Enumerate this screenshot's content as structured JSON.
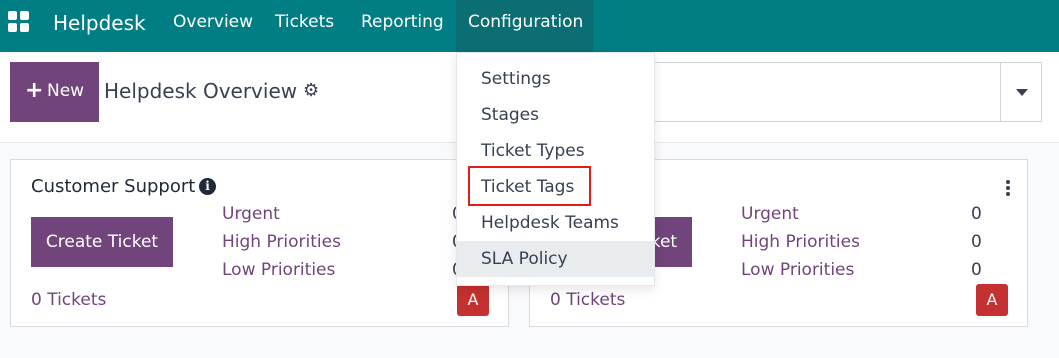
{
  "nav": {
    "brand": "Helpdesk",
    "items": [
      "Overview",
      "Tickets",
      "Reporting"
    ],
    "active": "Configuration"
  },
  "control": {
    "new_label": "New",
    "page_title": "Helpdesk Overview"
  },
  "config_menu": {
    "items": [
      "Settings",
      "Stages",
      "Ticket Types",
      "Ticket Tags",
      "Helpdesk Teams",
      "SLA Policy"
    ],
    "outlined": "Ticket Tags",
    "hovered": "SLA Policy"
  },
  "cards": [
    {
      "title": "Customer Support",
      "create_label": "Create Ticket",
      "stats": [
        {
          "label": "Urgent",
          "value": "0"
        },
        {
          "label": "High Priorities",
          "value": "0"
        },
        {
          "label": "Low Priorities",
          "value": "0"
        }
      ],
      "tickets": "0 Tickets",
      "avatar": "A"
    },
    {
      "title": "",
      "create_label": "Create Ticket",
      "stats": [
        {
          "label": "Urgent",
          "value": "0"
        },
        {
          "label": "High Priorities",
          "value": "0"
        },
        {
          "label": "Low Priorities",
          "value": "0"
        }
      ],
      "tickets": "0 Tickets",
      "avatar": "A"
    }
  ],
  "colors": {
    "navbar": "#017e84",
    "primary": "#71447b",
    "avatar": "#c53030",
    "outline": "#e21b1b"
  }
}
